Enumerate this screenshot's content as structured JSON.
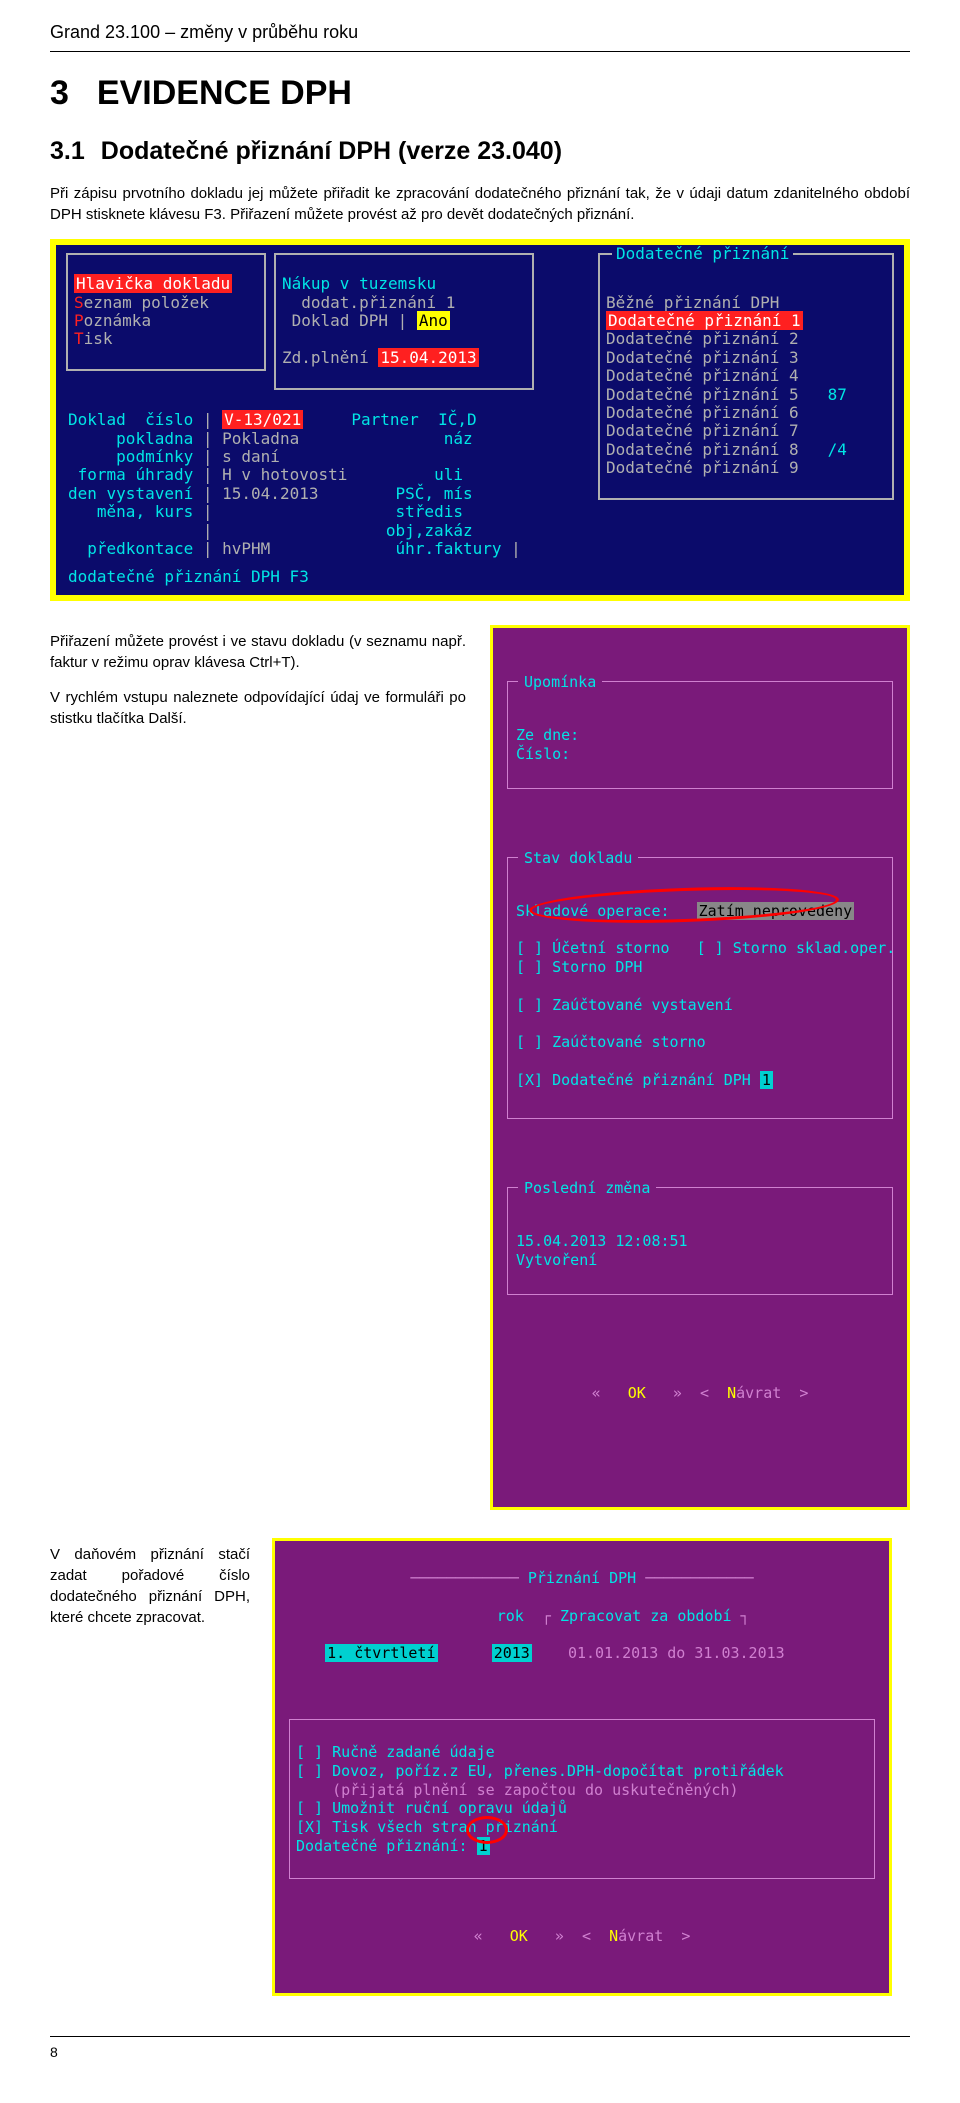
{
  "page": {
    "header": "Grand 23.100 – změny v průběhu roku",
    "footer": "8"
  },
  "section": {
    "num": "3",
    "title": "EVIDENCE DPH"
  },
  "subsection": {
    "num": "3.1",
    "title": "Dodatečné přiznání DPH (verze 23.040)"
  },
  "para1": "Při zápisu prvotního dokladu jej můžete přiřadit ke zpracování dodatečného přiznání tak, že v údaji datum zdanitelného období DPH stisknete klávesu F3. Přiřazení můžete provést až pro devět dodatečných přiznání.",
  "para2a": "Přiřazení můžete provést i ve stavu dokladu (v seznamu např. faktur v režimu oprav klávesa Ctrl+T).",
  "para2b": "V rychlém vstupu naleznete odpovídající údaj ve formuláři po stistku tlačítka Další.",
  "para3": "V daňovém přiznání stačí zadat pořadové číslo dodatečného přiznání DPH, které chcete zpracovat.",
  "shot1": {
    "menu": {
      "item1": {
        "pre": "",
        "label": "Hlavička dokladu"
      },
      "item2": {
        "hot": "S",
        "rest": "eznam položek"
      },
      "item3": {
        "hot": "P",
        "rest": "oznámka"
      },
      "item4": {
        "hot": "T",
        "rest": "isk"
      }
    },
    "nakup": {
      "title": "Nákup v tuzemsku",
      "r1a": "dodat.přiznání 1",
      "r2a": "Doklad DPH",
      "r2b": "Ano",
      "r3a": "Zd.plnění",
      "r3b": "15.04.2013"
    },
    "popup": {
      "title": "Dodatečné přiznání",
      "items": [
        "Běžné přiznání DPH",
        "Dodatečné přiznání 1",
        "Dodatečné přiznání 2",
        "Dodatečné přiznání 3",
        "Dodatečné přiznání 4",
        "Dodatečné přiznání 5",
        "Dodatečné přiznání 6",
        "Dodatečné přiznání 7",
        "Dodatečné přiznání 8",
        "Dodatečné přiznání 9"
      ],
      "right5": "87",
      "right8": "/4"
    },
    "form": {
      "r1l": "Doklad  číslo",
      "r1v": "V-13/021",
      "r1p": "Partner  IČ,D",
      "r2l": "pokladna",
      "r2v": "Pokladna",
      "r2p": "náz",
      "r3l": "podmínky",
      "r3v": "s daní",
      "r4l": "forma úhrady",
      "r4v": "H v hotovosti",
      "r4p": "uli",
      "r5l": "den vystavení",
      "r5v": "15.04.2013",
      "r5p": "PSČ, mís",
      "r6l": "měna, kurs",
      "r6p": "středis",
      "r7p": "obj,zakáz",
      "r8l": "předkontace",
      "r8v": "hvPHM",
      "r8p": "úhr.faktury"
    },
    "status": "dodatečné přiznání DPH F3"
  },
  "shot2": {
    "upomin": {
      "title": "Upomínka",
      "l1": "Ze dne:",
      "l2": "Číslo:"
    },
    "stav": {
      "title": "Stav dokladu",
      "r1a": "Skladové operace:",
      "r1b": "Zatím neprovedeny",
      "c1": "[ ] Účetní storno",
      "c1b": "[ ] Storno sklad.oper.",
      "c2": "[ ] Storno DPH",
      "c3": "[ ] Zaúčtované vystavení",
      "c4": "[ ] Zaúčtované storno",
      "c5a": "[X] Dodatečné přiznání DPH ",
      "c5b": "1"
    },
    "posledni": {
      "title": "Poslední změna",
      "l1": "15.04.2013 12:08:51",
      "l2": "Vytvoření"
    },
    "buttons": {
      "ok": "OK",
      "navrat_hot": "N",
      "navrat_rest": "ávrat"
    }
  },
  "shot3": {
    "title": "Přiznání DPH",
    "roklabel": "rok",
    "ctvrtleti": "1. čtvrtletí",
    "rok": "2013",
    "period_title": "Zpracovat za období",
    "period": "01.01.2013 do 31.03.2013",
    "c1": "[ ] Ručně zadané údaje",
    "c2": "[ ] Dovoz, poříz.z EU, přenes.DPH-dopočítat protiřádek",
    "c2sub": "(přijatá plnění se započtou do uskutečněných)",
    "c3": "[ ] Umožnit ruční opravu údajů",
    "c4": "[X] Tisk všech stran přiznání",
    "c5a": "Dodatečné přiznání:",
    "c5b": "1",
    "buttons": {
      "ok": "OK",
      "navrat_hot": "N",
      "navrat_rest": "ávrat"
    }
  }
}
